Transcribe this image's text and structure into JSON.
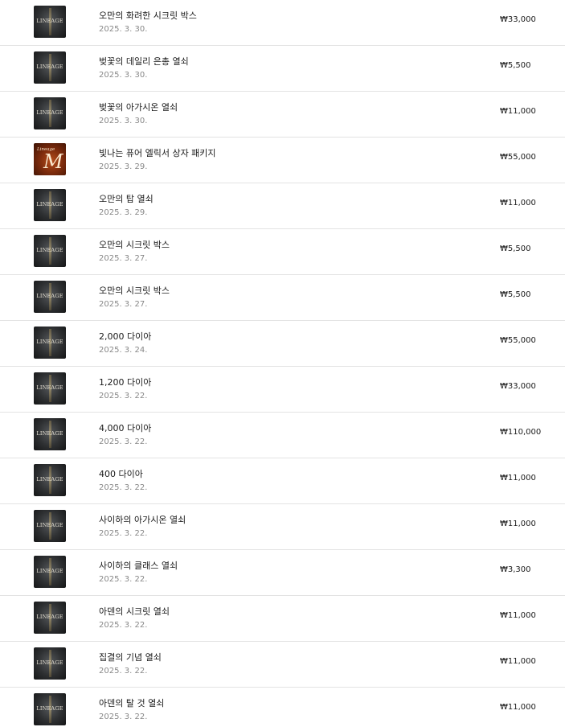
{
  "items": [
    {
      "title": "오만의 화려한 시크릿 박스",
      "date": "2025. 3. 30.",
      "price": "₩33,000",
      "icon": "lineage2-icon",
      "logo_text": "LINEAGE"
    },
    {
      "title": "벚꽃의 데일리 은총 열쇠",
      "date": "2025. 3. 30.",
      "price": "₩5,500",
      "icon": "lineage2-icon",
      "logo_text": "LINEAGE"
    },
    {
      "title": "벚꽃의 아가시온 열쇠",
      "date": "2025. 3. 30.",
      "price": "₩11,000",
      "icon": "lineage2-icon",
      "logo_text": "LINEAGE"
    },
    {
      "title": "빛나는 퓨어 엘릭서 상자 패키지",
      "date": "2025. 3. 29.",
      "price": "₩55,000",
      "icon": "lineage-m-icon",
      "logo_text": "Lineage",
      "logo_text_big": "M"
    },
    {
      "title": "오만의 탑 열쇠",
      "date": "2025. 3. 29.",
      "price": "₩11,000",
      "icon": "lineage2-icon",
      "logo_text": "LINEAGE"
    },
    {
      "title": "오만의 시크릿 박스",
      "date": "2025. 3. 27.",
      "price": "₩5,500",
      "icon": "lineage2-icon",
      "logo_text": "LINEAGE"
    },
    {
      "title": "오만의 시크릿 박스",
      "date": "2025. 3. 27.",
      "price": "₩5,500",
      "icon": "lineage2-icon",
      "logo_text": "LINEAGE"
    },
    {
      "title": "2,000 다이아",
      "date": "2025. 3. 24.",
      "price": "₩55,000",
      "icon": "lineage2-icon",
      "logo_text": "LINEAGE"
    },
    {
      "title": "1,200 다이아",
      "date": "2025. 3. 22.",
      "price": "₩33,000",
      "icon": "lineage2-icon",
      "logo_text": "LINEAGE"
    },
    {
      "title": "4,000 다이아",
      "date": "2025. 3. 22.",
      "price": "₩110,000",
      "icon": "lineage2-icon",
      "logo_text": "LINEAGE"
    },
    {
      "title": "400 다이아",
      "date": "2025. 3. 22.",
      "price": "₩11,000",
      "icon": "lineage2-icon",
      "logo_text": "LINEAGE"
    },
    {
      "title": "사이하의 아가시온 열쇠",
      "date": "2025. 3. 22.",
      "price": "₩11,000",
      "icon": "lineage2-icon",
      "logo_text": "LINEAGE"
    },
    {
      "title": "사이하의 클래스 열쇠",
      "date": "2025. 3. 22.",
      "price": "₩3,300",
      "icon": "lineage2-icon",
      "logo_text": "LINEAGE"
    },
    {
      "title": "아덴의 시크릿 열쇠",
      "date": "2025. 3. 22.",
      "price": "₩11,000",
      "icon": "lineage2-icon",
      "logo_text": "LINEAGE"
    },
    {
      "title": "집결의 기념 열쇠",
      "date": "2025. 3. 22.",
      "price": "₩11,000",
      "icon": "lineage2-icon",
      "logo_text": "LINEAGE"
    },
    {
      "title": "아덴의 탈 것 열쇠",
      "date": "2025. 3. 22.",
      "price": "₩11,000",
      "icon": "lineage2-icon",
      "logo_text": "LINEAGE"
    }
  ],
  "colors": {
    "divider": "#e3e3e3",
    "title_text": "#1a1a1a",
    "date_text": "#888888",
    "price_text": "#1a1a1a"
  }
}
